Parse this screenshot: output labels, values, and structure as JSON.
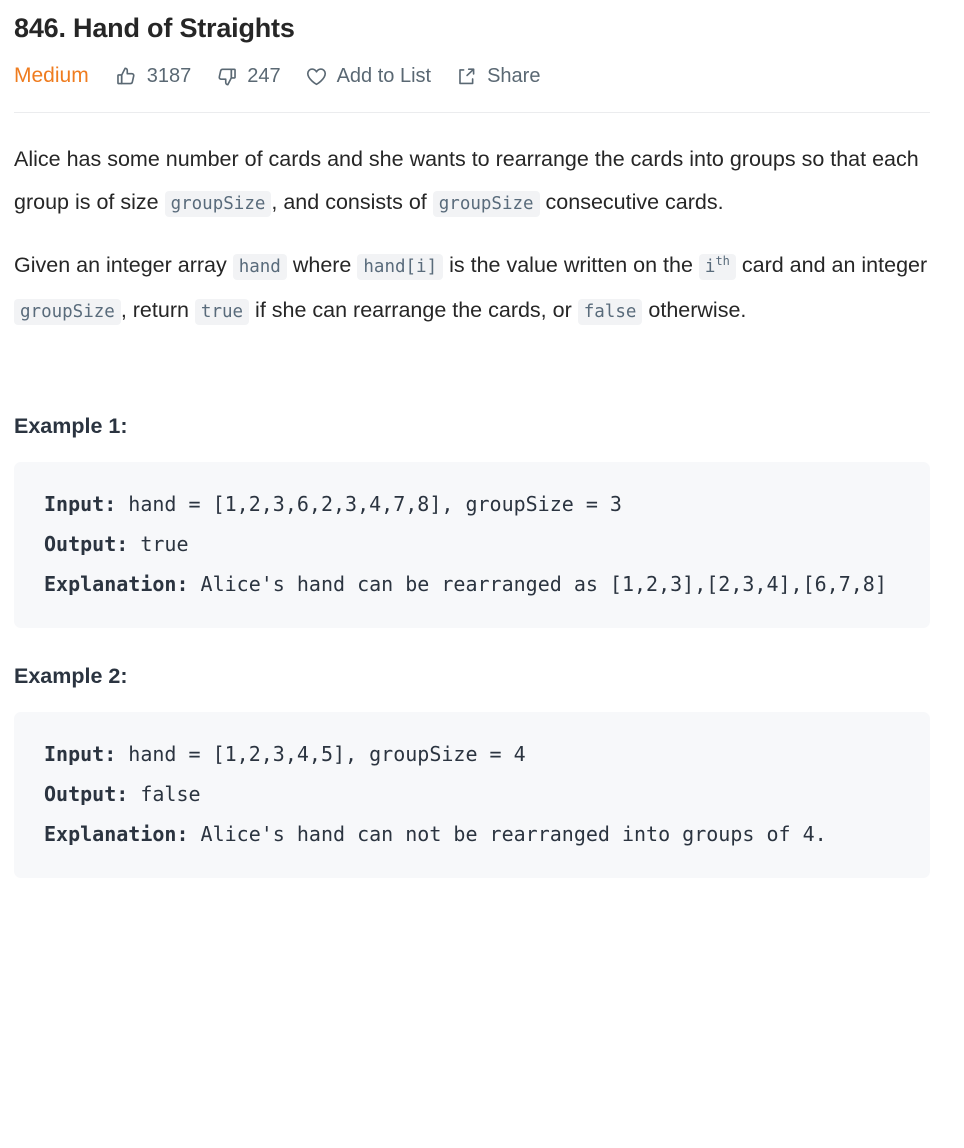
{
  "problem": {
    "title": "846. Hand of Straights",
    "difficulty": "Medium"
  },
  "meta": {
    "likes": "3187",
    "dislikes": "247",
    "add_to_list": "Add to List",
    "share": "Share",
    "icons": {
      "like": "thumbs-up-icon",
      "dislike": "thumbs-down-icon",
      "favorite": "heart-icon",
      "share": "share-icon"
    }
  },
  "description": {
    "p1": {
      "t1": "Alice has some number of cards and she wants to rearrange the cards into groups so that each group is of size ",
      "c1": "groupSize",
      "t2": ", and consists of ",
      "c2": "groupSize",
      "t3": " consecutive cards."
    },
    "p2": {
      "t1": "Given an integer array ",
      "c1": "hand",
      "t2": " where ",
      "c2": "hand[i]",
      "t3": " is the value written on the ",
      "c3_base": "i",
      "c3_sup": "th",
      "t4": " card and an integer ",
      "c4": "groupSize",
      "t5": ", return ",
      "c5": "true",
      "t6": " if she can rearrange the cards, or ",
      "c6": "false",
      "t7": " otherwise."
    }
  },
  "examples": [
    {
      "heading": "Example 1:",
      "input_label": "Input:",
      "input_value": " hand = [1,2,3,6,2,3,4,7,8], groupSize = 3",
      "output_label": "Output:",
      "output_value": " true",
      "explanation_label": "Explanation:",
      "explanation_value": " Alice's hand can be rearranged as [1,2,3],[2,3,4],[6,7,8]"
    },
    {
      "heading": "Example 2:",
      "input_label": "Input:",
      "input_value": " hand = [1,2,3,4,5], groupSize = 4",
      "output_label": "Output:",
      "output_value": " false",
      "explanation_label": "Explanation:",
      "explanation_value": " Alice's hand can not be rearranged into groups of 4."
    }
  ],
  "colors": {
    "difficulty_medium": "#ef7c1f",
    "code_bg": "#f7f8fa",
    "inline_code_bg": "#f2f3f5",
    "text": "#262626",
    "muted": "#5a6873"
  }
}
